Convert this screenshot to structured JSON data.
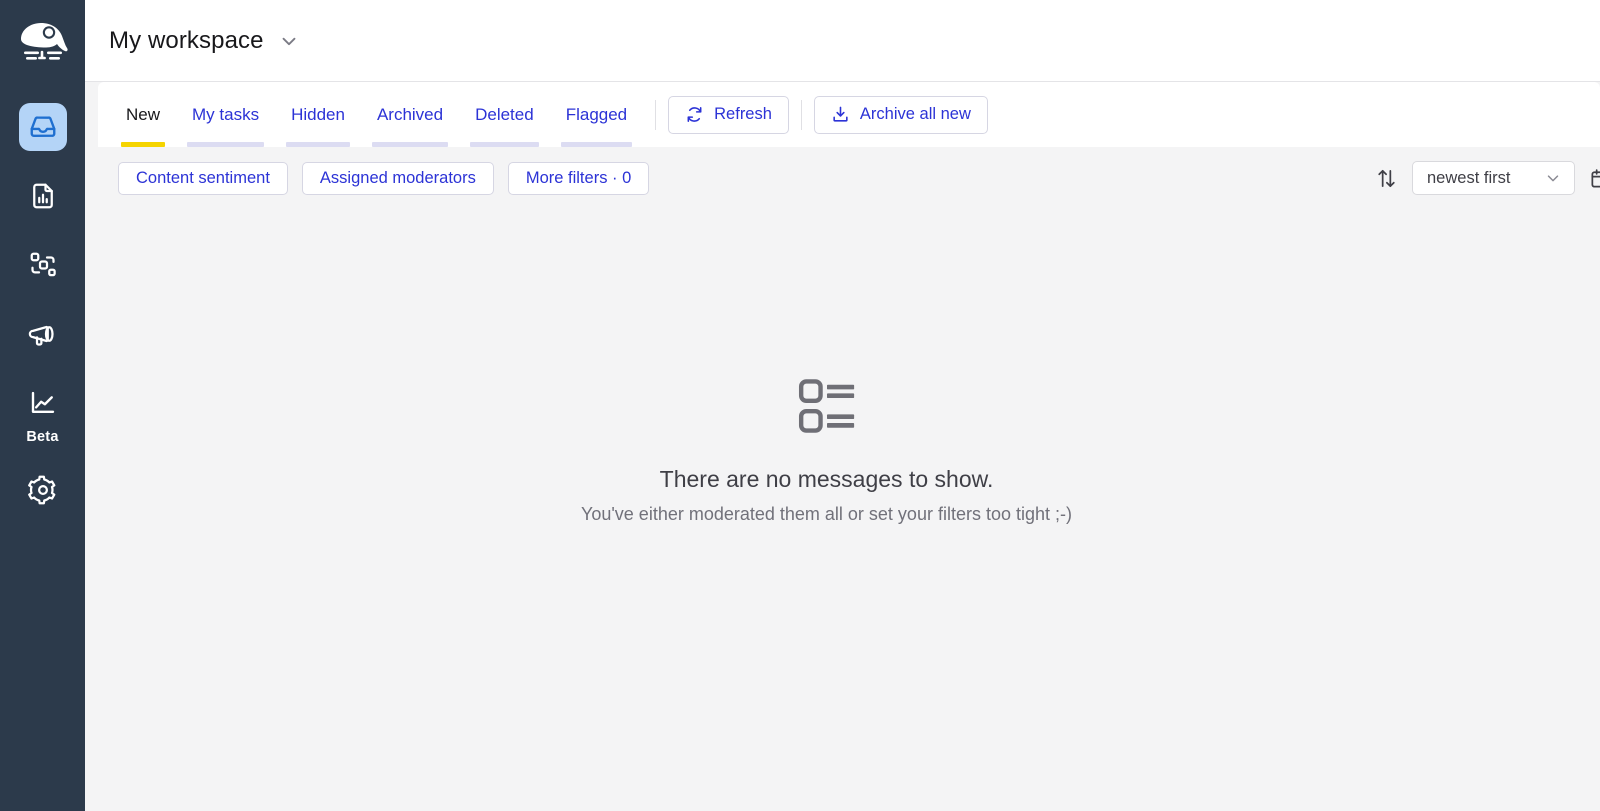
{
  "sidebar": {
    "logo": {
      "icon": "mole-logo-icon",
      "alt": "Mole logo"
    },
    "items": [
      {
        "id": "inbox",
        "icon": "inbox-icon",
        "label": "Inbox",
        "active": true
      },
      {
        "id": "reports",
        "icon": "report-chart-icon",
        "label": "Reports",
        "active": false
      },
      {
        "id": "routing",
        "icon": "routing-nodes-icon",
        "label": "Routing",
        "active": false
      },
      {
        "id": "campaigns",
        "icon": "megaphone-icon",
        "label": "Campaigns",
        "active": false
      },
      {
        "id": "analytics",
        "icon": "line-chart-icon",
        "label": "Analytics",
        "active": false,
        "badge": "Beta"
      },
      {
        "id": "settings",
        "icon": "gear-icon",
        "label": "Settings",
        "active": false
      }
    ],
    "beta_label": "Beta"
  },
  "header": {
    "workspace_title": "My workspace",
    "chevron_icon": "chevron-down-icon"
  },
  "tabs": [
    {
      "label": "New",
      "active": true
    },
    {
      "label": "My tasks",
      "active": false
    },
    {
      "label": "Hidden",
      "active": false
    },
    {
      "label": "Archived",
      "active": false
    },
    {
      "label": "Deleted",
      "active": false
    },
    {
      "label": "Flagged",
      "active": false
    }
  ],
  "toolbar": {
    "refresh_label": "Refresh",
    "refresh_icon": "refresh-icon",
    "archive_label": "Archive all new",
    "archive_icon": "archive-download-icon"
  },
  "filters": {
    "chips": [
      {
        "label": "Content sentiment"
      },
      {
        "label": "Assigned moderators"
      },
      {
        "label": "More filters · 0"
      }
    ],
    "sort_icon": "sort-arrows-icon",
    "sort_value": "newest first",
    "sort_chevron_icon": "chevron-down-icon",
    "calendar_icon": "calendar-icon"
  },
  "empty_state": {
    "icon": "list-items-icon",
    "title": "There are no messages to show.",
    "subtitle": "You've either moderated them all or set your filters too tight ;-)"
  },
  "colors": {
    "sidebar_bg": "#2c3a4b",
    "content_bg": "#f4f4f5",
    "link_blue": "#2c33d6",
    "active_tab_underline": "#f5d400",
    "inactive_tab_underline": "#dcdcf2",
    "active_nav_bg": "#b4d4f7",
    "active_nav_icon": "#1f6fd0"
  }
}
